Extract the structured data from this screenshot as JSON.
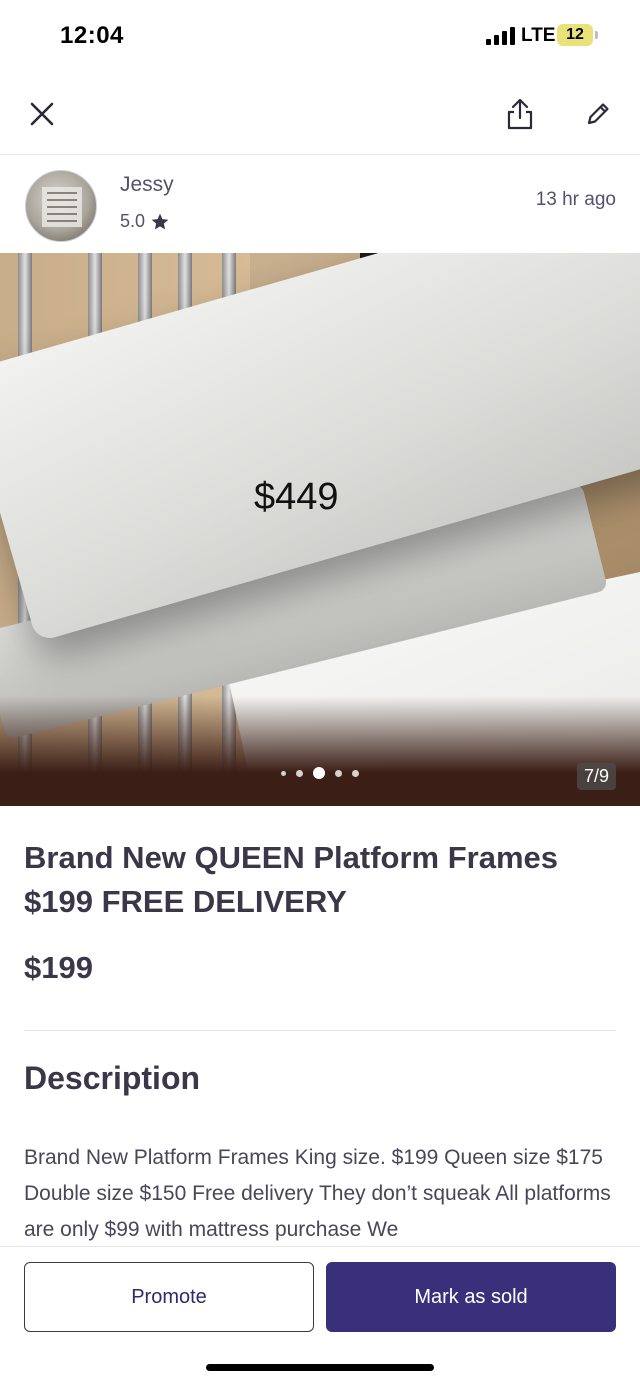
{
  "status_bar": {
    "time": "12:04",
    "network": "LTE",
    "battery": "12"
  },
  "nav": {
    "close_icon": "close-icon",
    "share_icon": "share-icon",
    "edit_icon": "pencil-icon"
  },
  "seller": {
    "name": "Jessy",
    "rating": "5.0",
    "posted": "13 hr ago"
  },
  "photo": {
    "overlay_price": "$449",
    "counter": "7/9",
    "dots_total": 5,
    "active_dot": 3
  },
  "listing": {
    "title": "Brand New QUEEN Platform Frames $199 FREE DELIVERY",
    "price": "$199",
    "description_heading": "Description",
    "description": "Brand New Platform Frames King size. $199 Queen size $175 Double size $150 Free delivery They don’t squeak All platforms are only $99 with mattress purchase We"
  },
  "actions": {
    "promote": "Promote",
    "mark_sold": "Mark as sold"
  },
  "colors": {
    "primary": "#3a2f7a",
    "text": "#3b3748",
    "muted": "#55516a"
  }
}
